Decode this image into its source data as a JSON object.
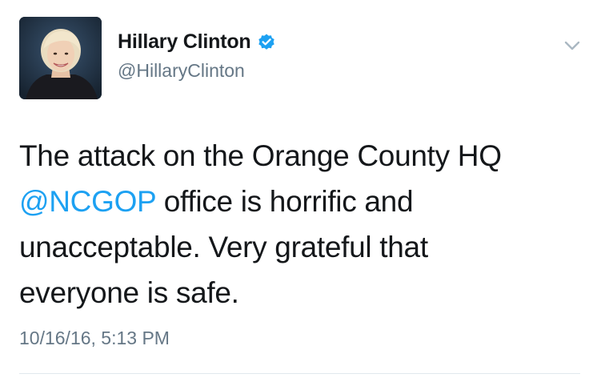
{
  "author": {
    "display_name": "Hillary Clinton",
    "handle": "@HillaryClinton",
    "verified": true,
    "avatar_icon": "profile-photo"
  },
  "tweet": {
    "line1": "The attack on the Orange County HQ",
    "mention": "@NCGOP",
    "line2_rest": " office is horrific and",
    "line3": "unacceptable. Very grateful that",
    "line4": "everyone is safe.",
    "timestamp": "10/16/16, 5:13 PM"
  },
  "colors": {
    "link": "#1da1f2",
    "secondary_text": "#657786",
    "primary_text": "#14171a",
    "verified_badge": "#1da1f2",
    "divider": "#e1e8ed"
  },
  "icons": {
    "verified": "verified-badge-icon",
    "menu": "chevron-down-icon"
  }
}
